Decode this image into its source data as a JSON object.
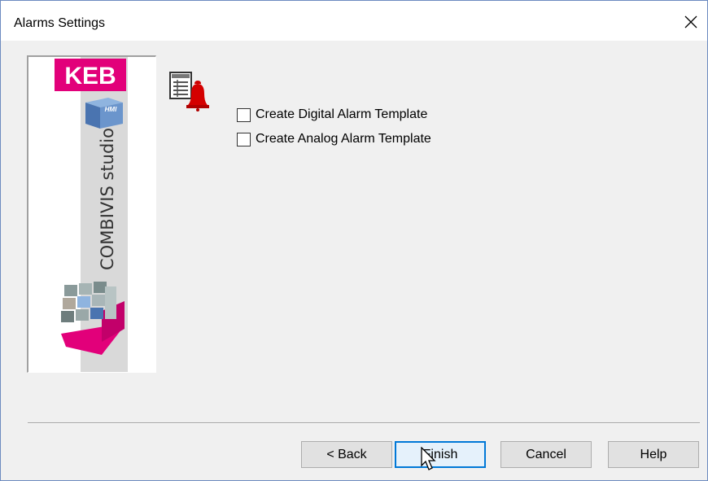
{
  "window": {
    "title": "Alarms Settings",
    "close_glyph": "✕"
  },
  "banner": {
    "logo_text": "KEB",
    "product_text": "COMBIVIS studio",
    "badge_text": "HMI",
    "colors": {
      "brand_magenta": "#e2007a"
    }
  },
  "options": {
    "icon": "alarm-bell-table-icon",
    "digital": {
      "label": "Create Digital Alarm Template",
      "checked": false
    },
    "analog": {
      "label": "Create Analog Alarm Template",
      "checked": false
    }
  },
  "buttons": {
    "back": "< Back",
    "finish": "Finish",
    "cancel": "Cancel",
    "help": "Help"
  }
}
